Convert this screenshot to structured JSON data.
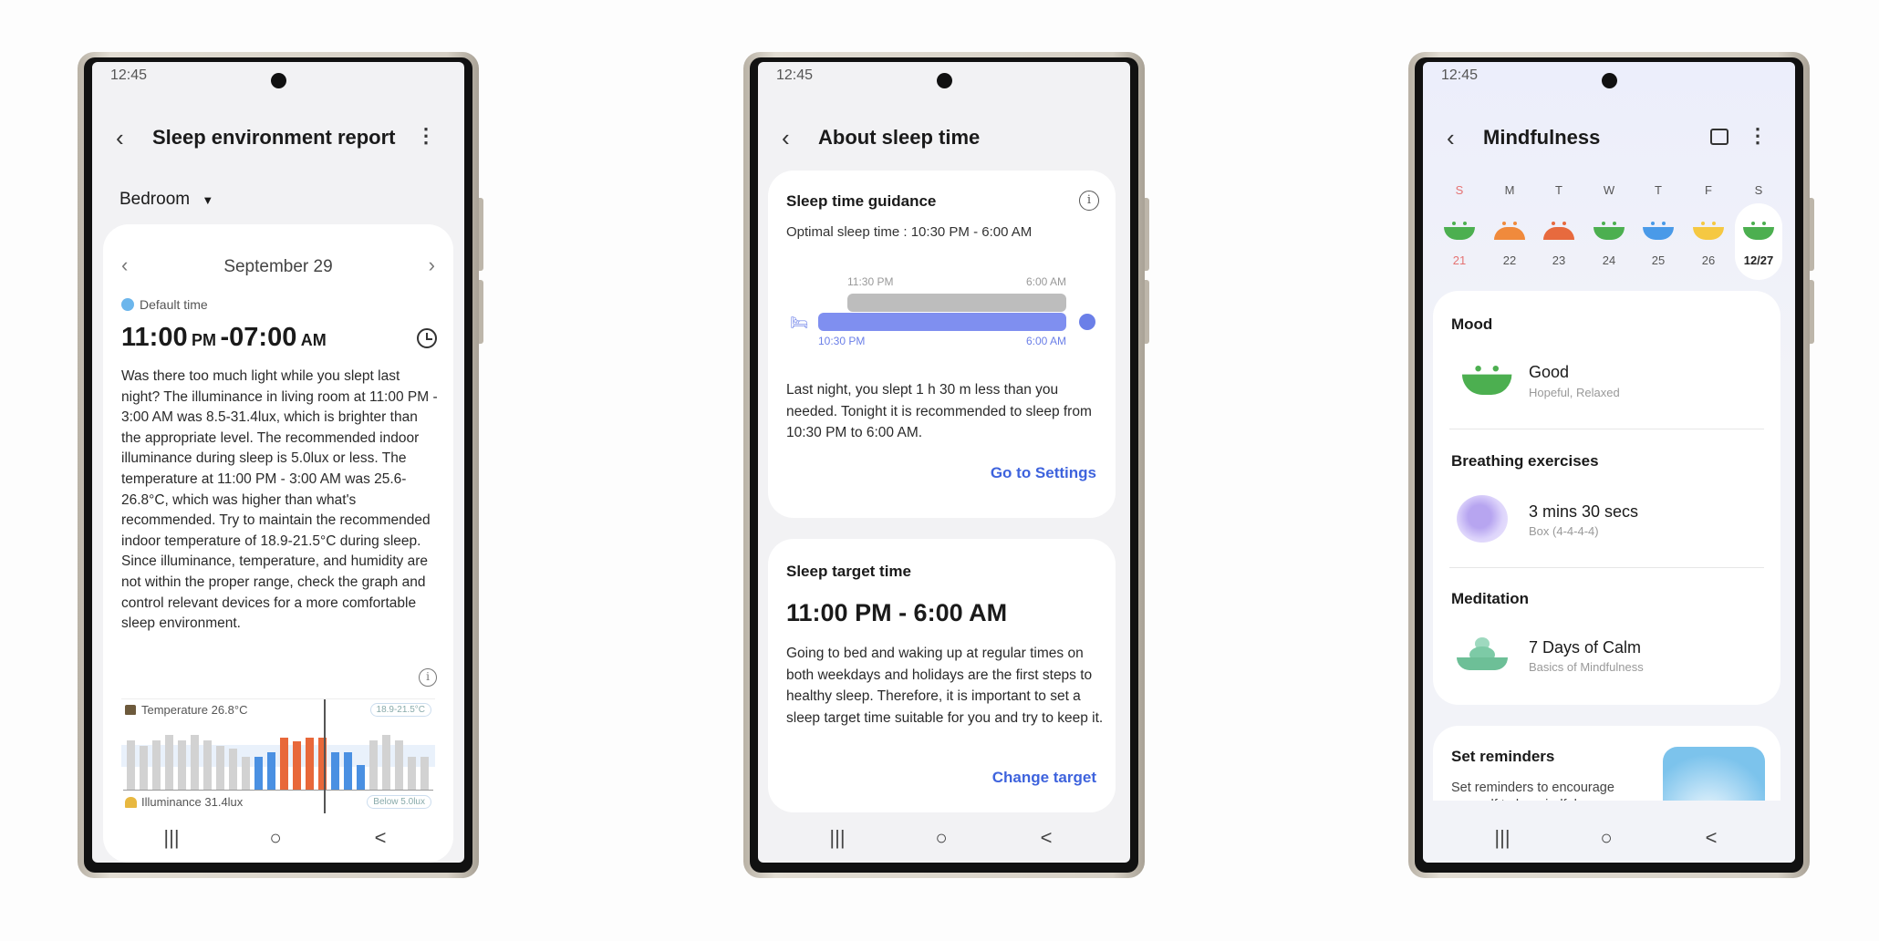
{
  "status_time": "12:45",
  "nav": {
    "recents": "|||",
    "home": "○",
    "back": "<"
  },
  "phone1": {
    "title": "Sleep environment report",
    "room": "Bedroom",
    "date": "September 29",
    "default_time_label": "Default time",
    "time_start": "11:00",
    "start_suffix": "PM",
    "time_sep": "-",
    "time_end": "07:00",
    "end_suffix": "AM",
    "description": "Was there too much light while you slept last night? The illuminance in living room at 11:00 PM - 3:00 AM was 8.5-31.4lux, which is brighter than the appropriate level. The recommended indoor illuminance during sleep is 5.0lux or less. The temperature at 11:00 PM - 3:00 AM was 25.6-26.8°C, which was higher than what's recommended. Try to maintain the recommended indoor temperature of 18.9-21.5°C during sleep. Since illuminance, temperature, and humidity are not within the proper range, check the graph and control relevant devices for a more comfortable sleep environment.",
    "temperature_label": "Temperature 26.8°C",
    "temperature_range": "18.9-21.5°C",
    "illuminance_label": "Illuminance 31.4lux",
    "illuminance_range": "Below 5.0lux",
    "colors": {
      "normal": "#d2d2d2",
      "low": "#4a90e2",
      "high": "#e8683a"
    },
    "temperature_bars": [
      {
        "level": 0.9,
        "status": "normal"
      },
      {
        "level": 0.8,
        "status": "normal"
      },
      {
        "level": 0.9,
        "status": "normal"
      },
      {
        "level": 1.0,
        "status": "normal"
      },
      {
        "level": 0.9,
        "status": "normal"
      },
      {
        "level": 1.0,
        "status": "normal"
      },
      {
        "level": 0.9,
        "status": "normal"
      },
      {
        "level": 0.8,
        "status": "normal"
      },
      {
        "level": 0.75,
        "status": "normal"
      },
      {
        "level": 0.6,
        "status": "normal"
      },
      {
        "level": 0.6,
        "status": "low"
      },
      {
        "level": 0.68,
        "status": "low"
      },
      {
        "level": 0.95,
        "status": "high"
      },
      {
        "level": 0.88,
        "status": "high"
      },
      {
        "level": 0.95,
        "status": "high"
      },
      {
        "level": 0.95,
        "status": "high"
      },
      {
        "level": 0.68,
        "status": "low"
      },
      {
        "level": 0.68,
        "status": "low"
      },
      {
        "level": 0.45,
        "status": "low"
      },
      {
        "level": 0.9,
        "status": "normal"
      },
      {
        "level": 1.0,
        "status": "normal"
      },
      {
        "level": 0.9,
        "status": "normal"
      },
      {
        "level": 0.6,
        "status": "normal"
      },
      {
        "level": 0.6,
        "status": "normal"
      }
    ]
  },
  "phone2": {
    "title": "About sleep time",
    "guidance_title": "Sleep time guidance",
    "optimal": "Optimal sleep time : 10:30 PM - 6:00 AM",
    "actual_start": "11:30 PM",
    "actual_end": "6:00 AM",
    "optimal_start": "10:30 PM",
    "optimal_end": "6:00 AM",
    "guidance_text": "Last night, you slept 1 h 30 m less than you needed. Tonight it is recommended to sleep from 10:30 PM to 6:00 AM.",
    "go_settings": "Go to Settings",
    "target_title": "Sleep target time",
    "target_time": "11:00 PM - 6:00 AM",
    "target_text": "Going to bed and waking up at regular times on both weekdays and holidays are the first steps to healthy sleep. Therefore, it is important to set a sleep target time suitable for you and try to keep it.",
    "change_target": "Change target"
  },
  "phone3": {
    "title": "Mindfulness",
    "days": [
      {
        "letter": "S",
        "date": "21",
        "mood": "happy",
        "color": "#4caf50"
      },
      {
        "letter": "M",
        "date": "22",
        "mood": "sad",
        "color": "#f08a3c"
      },
      {
        "letter": "T",
        "date": "23",
        "mood": "sad",
        "color": "#e76a3e"
      },
      {
        "letter": "W",
        "date": "24",
        "mood": "happy",
        "color": "#4caf50"
      },
      {
        "letter": "T",
        "date": "25",
        "mood": "happy",
        "color": "#4a9ae8"
      },
      {
        "letter": "F",
        "date": "26",
        "mood": "happy",
        "color": "#f5c842"
      },
      {
        "letter": "S",
        "date": "12/27",
        "mood": "happy",
        "color": "#4caf50",
        "selected": true
      }
    ],
    "mood_title": "Mood",
    "mood_value": "Good",
    "mood_sub": "Hopeful, Relaxed",
    "breathing_title": "Breathing exercises",
    "breathing_value": "3 mins 30 secs",
    "breathing_sub": "Box (4-4-4-4)",
    "meditation_title": "Meditation",
    "meditation_value": "7 Days of Calm",
    "meditation_sub": "Basics of Mindfulness",
    "reminders_title": "Set reminders",
    "reminders_text": "Set reminders to encourage yourself to be mindful"
  }
}
